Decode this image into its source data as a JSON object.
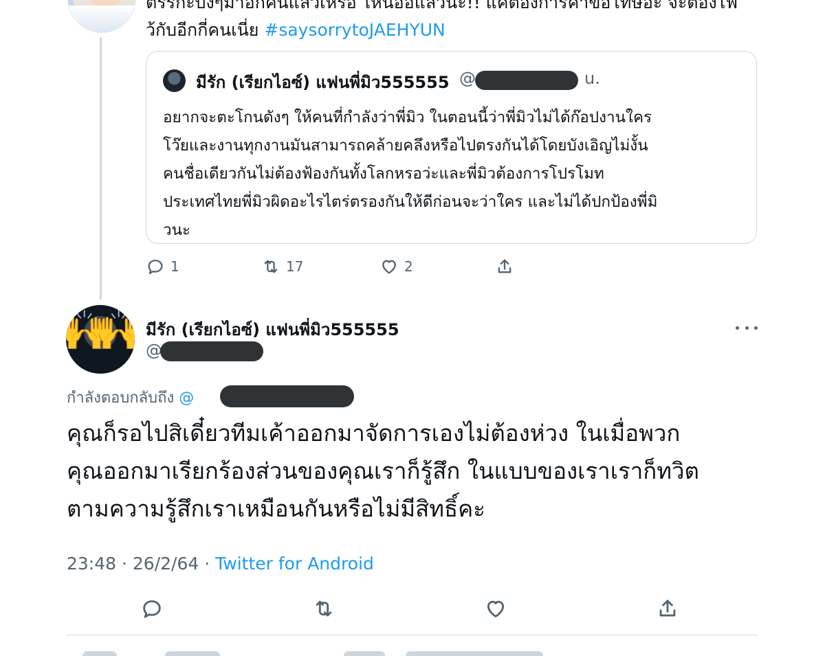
{
  "previous_tweet": {
    "text_lines": [
      "ตรรกะบังๆมาอีกคนแล้วเหรอ ไหนอีอีแล้วนะ!! แค่ต้องการคำขอโทษอะ จะต้องไฟ",
      "ว้กับอีกกี่คนเนี่ย"
    ],
    "hashtag": "#saysorrytoJAEHYUN",
    "quoted": {
      "name": "มีรัก (เรียกไอซ์) แฟนพี่มิว555555",
      "handle_prefix": "@",
      "handle_suffix": "u.",
      "text_lines": [
        "อยากจะตะโกนดังๆ ให้คนที่กำลังว่าพี่มิว ในตอนนี้ว่าพี่มิวไม่ได้ก๊อปงานใคร",
        "โว๊ยและงานทุกงานมันสามารถคล้ายคลึงหรือไปตรงกันได้โดยบังเอิญไม่งั้น",
        "คนชื่อเดียวกันไม่ต้องฟ้องกันทั้งโลกหรอว่ะและพี่มิวต้องการโปรโมท",
        "ประเทศไทยพี่มิวผิดอะไรไตร่ตรองกันให้ดีก่อนจะว่าใคร และไม่ได้ปกป้องพี่มิ",
        "วนะ"
      ]
    },
    "actions": {
      "reply_count": "1",
      "retweet_count": "17",
      "like_count": "2"
    }
  },
  "main_tweet": {
    "name": "มีรัก (เรียกไอซ์) แฟนพี่มิว555555",
    "handle_prefix": "@",
    "reply_label": "กำลังตอบกลับถึง",
    "reply_at": "@",
    "text_lines": [
      "คุณก็รอไปสิเดี๋ยวทีมเค้าออกมาจัดการเองไม่ต้องห่วง ในเมื่อพวก",
      "คุณออกมาเรียกร้องส่วนของคุณเราก็รู้สึก ในแบบของเราเราก็ทวิต",
      "ตามความรู้สึกเราเหมือนกันหรือไม่มีสิทธิ์คะ"
    ],
    "time": "23:48",
    "date": "26/2/64",
    "separator": "·",
    "source": "Twitter for Android"
  },
  "icons": {
    "reply": "reply-icon",
    "retweet": "retweet-icon",
    "like": "heart-icon",
    "share": "share-icon",
    "more": "more-icon",
    "avatar_emoji": "🙌"
  },
  "colors": {
    "link": "#1d9bf0",
    "secondary_text": "#536471",
    "border": "#cfd9de",
    "redaction": "#2f3336"
  }
}
